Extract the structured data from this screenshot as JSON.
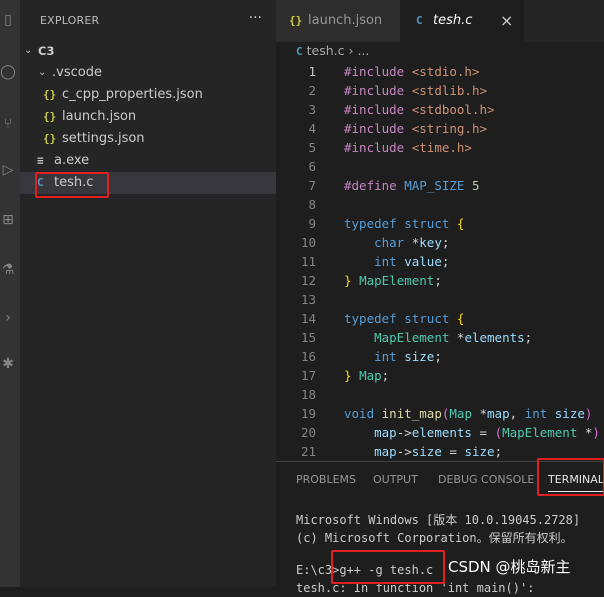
{
  "activity_bar": {
    "icons": [
      "files-icon",
      "search-icon",
      "source-control-icon",
      "run-debug-icon",
      "extensions-icon",
      "testing-icon",
      "remote-icon",
      "settings-icon"
    ]
  },
  "explorer": {
    "title": "EXPLORER",
    "more": "···",
    "root": "C3",
    "items": [
      {
        "label": ".vscode",
        "icon": "chevron-down"
      },
      {
        "label": "c_cpp_properties.json",
        "icon": "{}"
      },
      {
        "label": "launch.json",
        "icon": "{}"
      },
      {
        "label": "settings.json",
        "icon": "{}"
      },
      {
        "label": "a.exe",
        "icon": "≡"
      },
      {
        "label": "tesh.c",
        "icon": "C"
      }
    ]
  },
  "tabs": [
    {
      "label": "launch.json",
      "icon": "{}"
    },
    {
      "label": "tesh.c",
      "icon": "C",
      "close": "×"
    }
  ],
  "breadcrumb": {
    "file": "tesh.c",
    "sep": "›",
    "rest": "..."
  },
  "code_lines": [
    "#include <stdio.h>",
    "#include <stdlib.h>",
    "#include <stdbool.h>",
    "#include <string.h>",
    "#include <time.h>",
    "",
    "#define MAP_SIZE 5",
    "",
    "typedef struct {",
    "    char *key;",
    "    int value;",
    "} MapElement;",
    "",
    "typedef struct {",
    "    MapElement *elements;",
    "    int size;",
    "} Map;",
    "",
    "void init_map(Map *map, int size)",
    "    map->elements = (MapElement *)",
    "    map->size = size;"
  ],
  "panel": {
    "tabs": [
      "PROBLEMS",
      "OUTPUT",
      "DEBUG CONSOLE",
      "TERMINAL"
    ],
    "terminal_lines": [
      "Microsoft Windows [版本 10.0.19045.2728]",
      "(c) Microsoft Corporation。保留所有权利。",
      "",
      "E:\\c3>g++ -g tesh.c",
      "tesh.c: In function 'int main()':"
    ]
  },
  "watermark": "CSDN @桃岛新主",
  "colors": {
    "highlight_box": "#e02020",
    "sidebar": "#252526",
    "editor": "#1e1e1e",
    "activity": "#333333"
  }
}
